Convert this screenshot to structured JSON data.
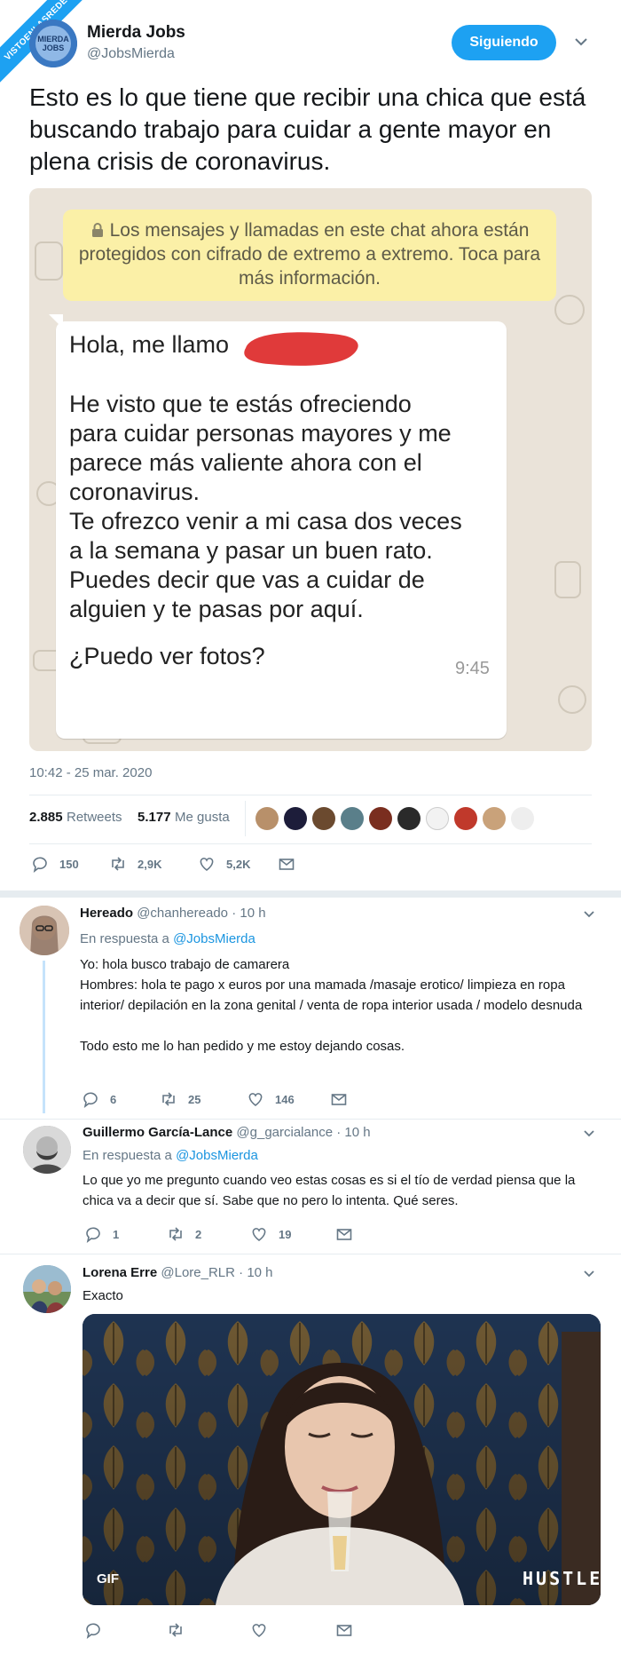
{
  "site_ribbon": "VISTOENLASREDES",
  "tweet": {
    "author_name": "Mierda Jobs",
    "author_handle": "@JobsMierda",
    "follow_label": "Siguiendo",
    "text": "Esto es lo que tiene que recibir una chica que está buscando trabajo para cuidar a gente mayor en plena crisis de coronavirus.",
    "timestamp": "10:42 - 25 mar. 2020",
    "retweets_num": "2.885",
    "retweets_label": "Retweets",
    "likes_num": "5.177",
    "likes_label": "Me gusta",
    "actions": {
      "replies": "150",
      "retweets": "2,9K",
      "likes": "5,2K"
    }
  },
  "chat": {
    "encryption_notice": "Los mensajes y llamadas en este chat ahora están protegidos con cifrado de extremo a extremo. Toca para más información.",
    "msg_line1": "Hola, me llamo",
    "msg_para1": "He visto que te estás ofreciendo para cuidar personas mayores y me parece más valiente ahora con el coronavirus.",
    "msg_para2": "Te ofrezco venir a mi casa dos veces a la semana y pasar un buen rato. Puedes decir que vas a cuidar de alguien y te pasas por aquí.",
    "msg_para3": "¿Puedo ver fotos?",
    "msg_time": "9:45"
  },
  "replies": [
    {
      "name": "Hereado",
      "handle": "@chanhereado",
      "time": "· 10 h",
      "in_reply_prefix": "En respuesta a",
      "in_reply_to": "@JobsMierda",
      "text": "Yo: hola busco trabajo de camarera\nHombres: hola te pago x euros por una mamada /masaje erotico/ limpieza en ropa interior/ depilación en la zona genital / venta de ropa interior usada / modelo desnuda\n\nTodo esto me lo han pedido y me estoy dejando cosas.",
      "actions": {
        "replies": "6",
        "retweets": "25",
        "likes": "146"
      }
    },
    {
      "name": "Guillermo García-Lance",
      "handle": "@g_garcialance",
      "time": "· 10 h",
      "in_reply_prefix": "En respuesta a",
      "in_reply_to": "@JobsMierda",
      "text": "Lo que yo me pregunto cuando veo estas cosas es si el tío de verdad piensa que la chica va a decir que sí. Sabe que no pero lo intenta. Qué seres.",
      "actions": {
        "replies": "1",
        "retweets": "2",
        "likes": "19"
      }
    },
    {
      "name": "Lorena Erre",
      "handle": "@Lore_RLR",
      "time": "· 10 h",
      "text": "Exacto",
      "gif_badge": "GIF",
      "gif_watermark": "HUSTLE"
    }
  ],
  "colors": {
    "accent": "#1da1f2",
    "chat_bg": "#eae3d9",
    "notice_bg": "#fbf0a7",
    "redaction": "#e03a3a"
  }
}
